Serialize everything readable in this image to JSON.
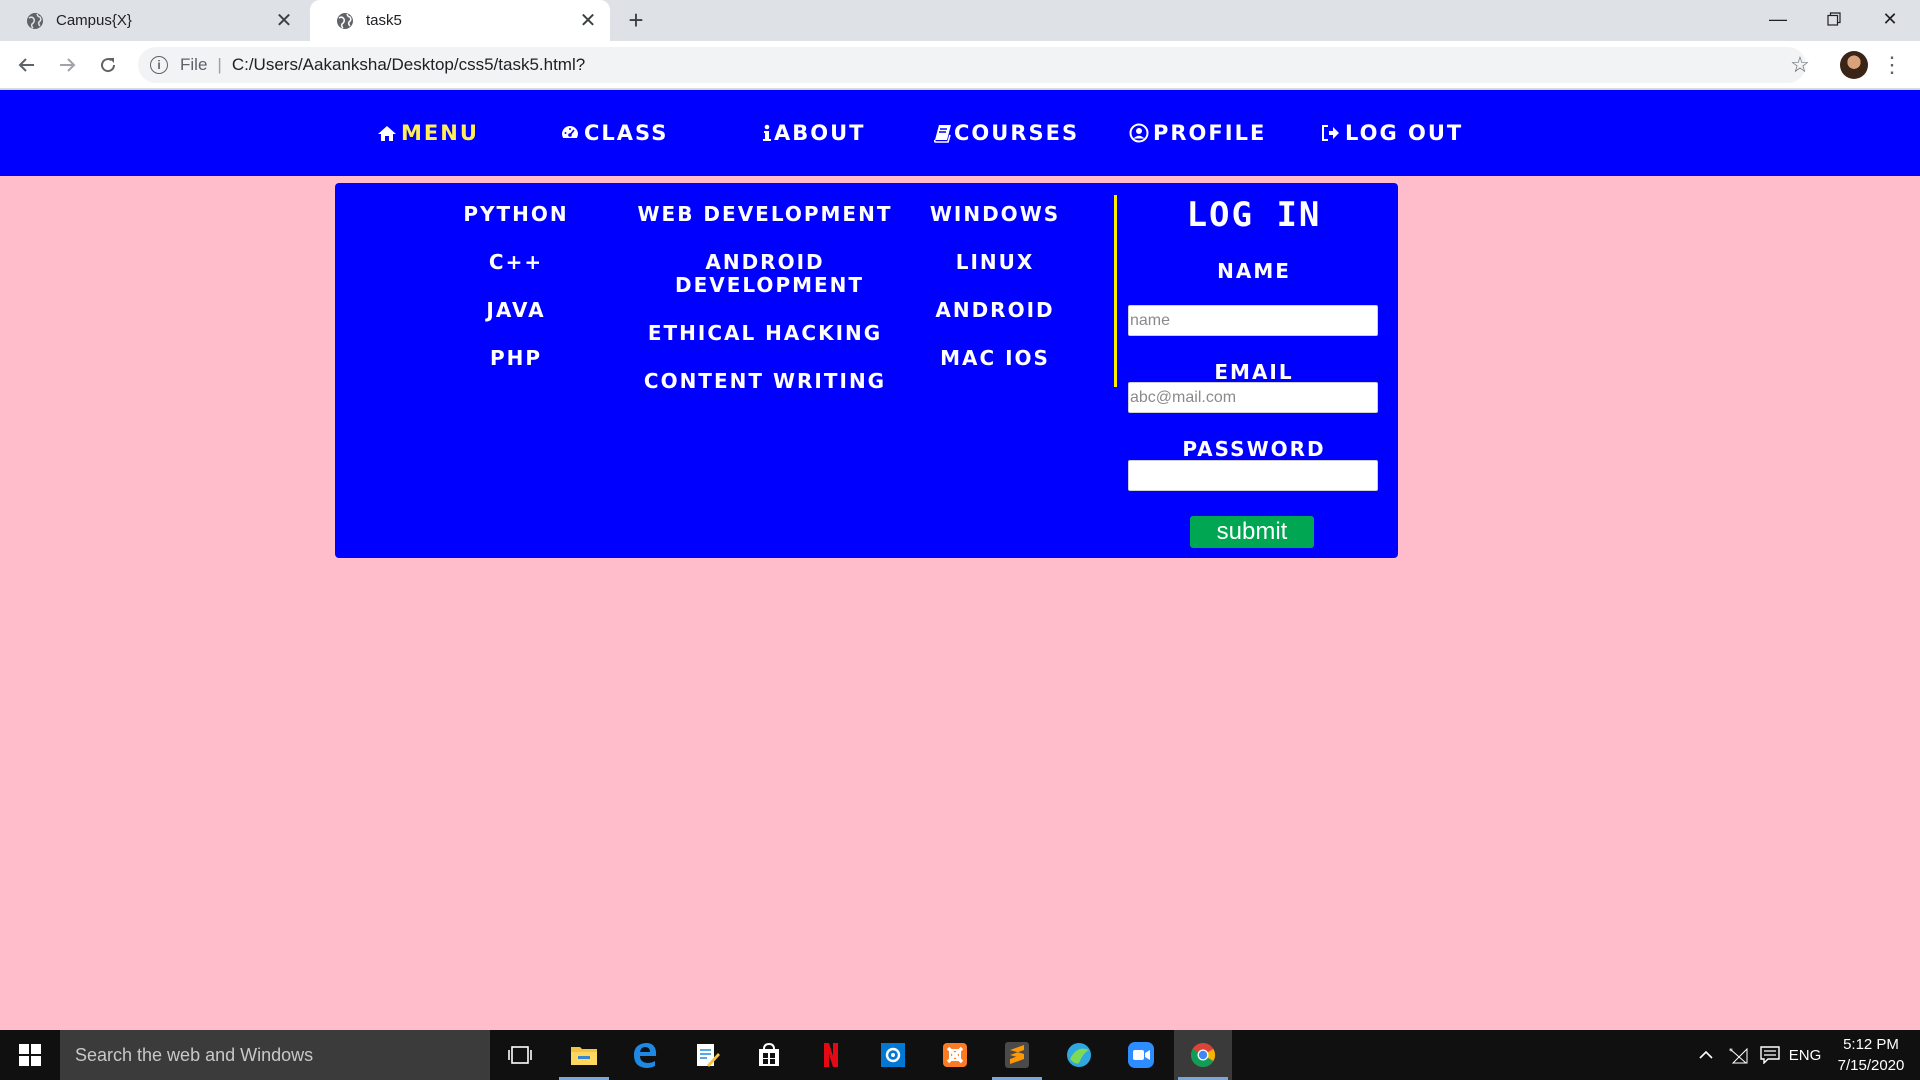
{
  "browser": {
    "tabs": [
      {
        "title": "Campus{X}",
        "active": false
      },
      {
        "title": "task5",
        "active": true
      }
    ],
    "address": {
      "scheme": "File",
      "url": "C:/Users/Aakanksha/Desktop/css5/task5.html?"
    }
  },
  "nav": {
    "items": [
      {
        "label": "MENU",
        "icon": "home-icon",
        "active": true
      },
      {
        "label": "CLASS",
        "icon": "dashboard-icon",
        "active": false
      },
      {
        "label": "ABOUT",
        "icon": "info-icon",
        "active": false
      },
      {
        "label": "COURSES",
        "icon": "book-icon",
        "active": false
      },
      {
        "label": "PROFILE",
        "icon": "user-circle-icon",
        "active": false
      },
      {
        "label": "LOG OUT",
        "icon": "sign-out-icon",
        "active": false
      }
    ]
  },
  "dropdown": {
    "col1": [
      "PYTHON",
      "C++",
      "JAVA",
      "PHP"
    ],
    "col2": [
      "WEB DEVELOPMENT",
      "ANDROID DEVELOPMENT",
      "ETHICAL HACKING",
      "CONTENT WRITING"
    ],
    "col3": [
      "WINDOWS",
      "LINUX",
      "ANDROID",
      "MAC IOS"
    ]
  },
  "login": {
    "title": "LOG IN",
    "name_label": "NAME",
    "name_placeholder": "name",
    "email_label": "EMAIL",
    "email_placeholder": "abc@mail.com",
    "password_label": "PASSWORD",
    "password_placeholder": "",
    "submit_label": "submit"
  },
  "taskbar": {
    "search_placeholder": "Search the web and Windows",
    "language": "ENG",
    "time": "5:12 PM",
    "date": "7/15/2020"
  },
  "colors": {
    "page_bg": "#ffbcca",
    "nav_bg": "#0000ff",
    "active_nav": "#ffee55",
    "divider": "#ffee00",
    "submit_bg": "#00a651"
  }
}
